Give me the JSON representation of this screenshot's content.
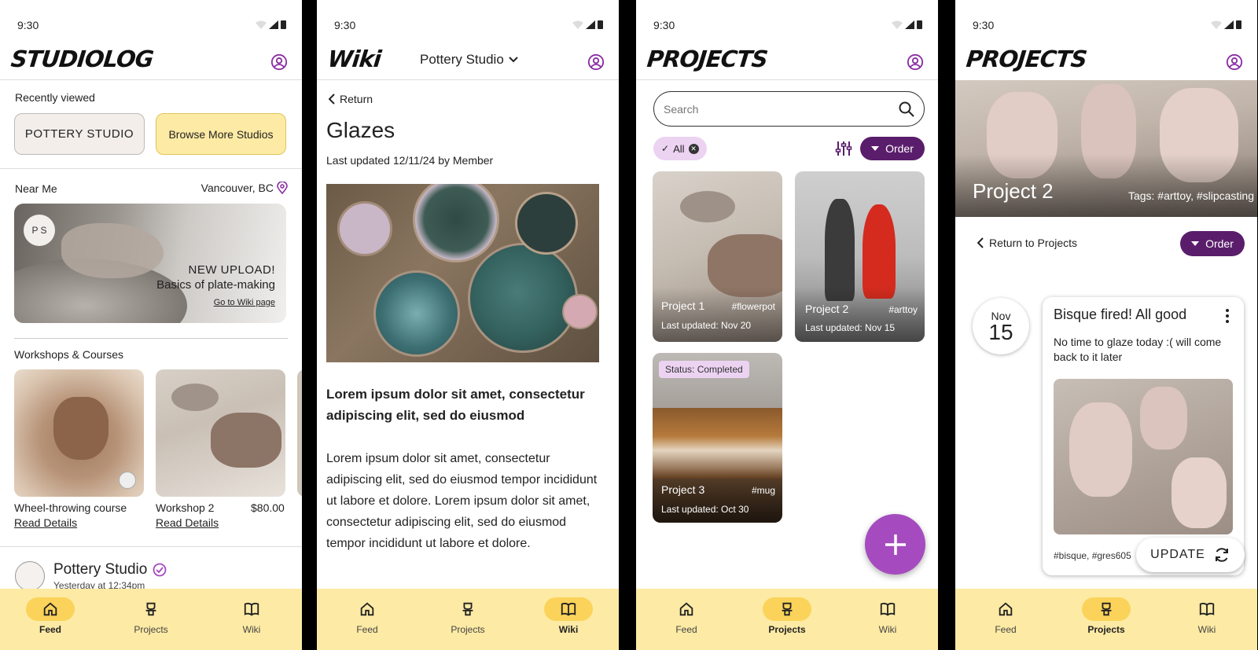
{
  "status": {
    "time": "9:30"
  },
  "tabs": {
    "feed": "Feed",
    "projects": "Projects",
    "wiki": "Wiki"
  },
  "screen1": {
    "brand": "STUDIOLOG",
    "recently_viewed": "Recently viewed",
    "pottery_logo": "POTTERY STUDIO",
    "browse_more": "Browse More Studios",
    "near_me": "Near Me",
    "location": "Vancouver, BC",
    "banner_badge": "P S",
    "banner_title1": "NEW UPLOAD!",
    "banner_title2": "Basics of plate-making",
    "banner_link": "Go to Wiki page",
    "workshops_header": "Workshops & Courses",
    "courses": [
      {
        "title": "Wheel-throwing course",
        "price": "",
        "link": "Read Details"
      },
      {
        "title": "Workshop 2",
        "price": "$80.00",
        "link": "Read Details"
      }
    ],
    "post_studio": "Pottery Studio",
    "post_time": "Yesterday at 12:34pm"
  },
  "screen2": {
    "brand": "Wiki",
    "studio_select": "Pottery Studio",
    "return": "Return",
    "title": "Glazes",
    "updated": "Last updated 12/11/24 by Member",
    "lead": "Lorem ipsum dolor sit amet, consectetur adipiscing elit, sed do eiusmod",
    "body": "Lorem ipsum dolor sit amet, consectetur adipiscing elit, sed do eiusmod tempor incididunt ut labore et dolore. Lorem ipsum dolor sit amet, consectetur adipiscing elit, sed do eiusmod tempor incididunt ut labore et dolore."
  },
  "screen3": {
    "brand": "PROJECTS",
    "search_placeholder": "Search",
    "chip_all": "All",
    "order": "Order",
    "projects": [
      {
        "name": "Project 1",
        "tag": "#flowerpot",
        "updated": "Last updated: Nov 20",
        "status": ""
      },
      {
        "name": "Project 2",
        "tag": "#arttoy",
        "updated": "Last updated: Nov 15",
        "status": ""
      },
      {
        "name": "Project 3",
        "tag": "#mug",
        "updated": "Last updated: Oct 30",
        "status": "Status: Completed"
      }
    ]
  },
  "screen4": {
    "brand": "PROJECTS",
    "hero_title": "Project 2",
    "hero_tags": "Tags: #arttoy, #slipcasting",
    "return": "Return to Projects",
    "order": "Order",
    "date_month": "Nov",
    "date_day": "15",
    "entry_title": "Bisque fired! All good",
    "entry_text": "No time to glaze today :( will come back to it later",
    "entry_tags": "#bisque, #gres605",
    "update": "UPDATE"
  },
  "colors": {
    "accent_purple": "#5a1d6b",
    "tab_bg": "#fdeaa4",
    "tab_active": "#fbd35a",
    "fab": "#a54bbf",
    "chip": "#ecd3f2"
  }
}
